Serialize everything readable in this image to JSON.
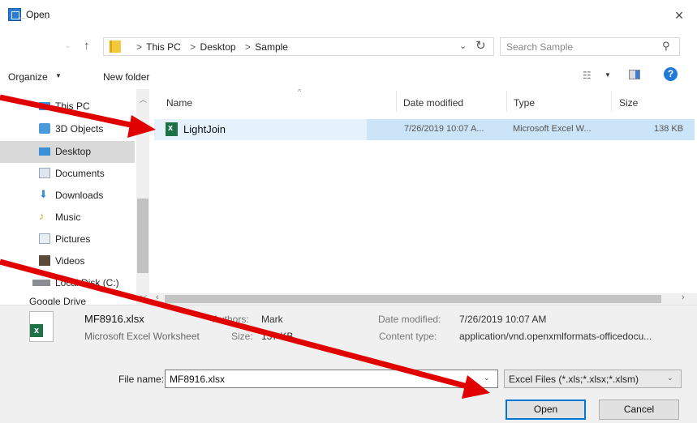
{
  "window": {
    "title": "Open",
    "close_glyph": "×"
  },
  "address": {
    "crumbs": [
      "This PC",
      "Desktop",
      "Sample"
    ],
    "separator": ">",
    "search_placeholder": "Search Sample"
  },
  "toolbar": {
    "organize": "Organize",
    "new_folder": "New folder"
  },
  "sidebar": {
    "items": [
      {
        "label": "This PC",
        "icon": "computer-icon",
        "color": "#3b8ed8"
      },
      {
        "label": "3D Objects",
        "icon": "cube-icon",
        "color": "#4a9bd8"
      },
      {
        "label": "Desktop",
        "icon": "desktop-icon",
        "color": "#3b8ed8",
        "selected": true
      },
      {
        "label": "Documents",
        "icon": "document-icon",
        "color": "#9aa7b8"
      },
      {
        "label": "Downloads",
        "icon": "download-icon",
        "color": "#3b8ed8"
      },
      {
        "label": "Music",
        "icon": "music-icon",
        "color": "#e2a12b"
      },
      {
        "label": "Pictures",
        "icon": "picture-icon",
        "color": "#9aa7b8"
      },
      {
        "label": "Videos",
        "icon": "video-icon",
        "color": "#5b4a3a"
      },
      {
        "label": "Local Disk (C:)",
        "icon": "drive-icon",
        "color": "#8a8f96"
      },
      {
        "label": "Google Drive",
        "icon": "drive-icon",
        "color": "#8a8f96"
      }
    ]
  },
  "columns": {
    "name": "Name",
    "date": "Date modified",
    "type": "Type",
    "size": "Size"
  },
  "files": [
    {
      "name": "LightJoin",
      "date": "7/26/2019 10:07 A...",
      "type": "Microsoft Excel W...",
      "size": "138 KB"
    }
  ],
  "details": {
    "name": "MF8916.xlsx",
    "kind": "Microsoft Excel Worksheet",
    "authors_label": "Authors:",
    "authors_value": "Mark",
    "size_label": "Size:",
    "size_value": "137 KB",
    "modified_label": "Date modified:",
    "modified_value": "7/26/2019 10:07 AM",
    "content_label": "Content type:",
    "content_value": "application/vnd.openxmlformats-officedocu..."
  },
  "footer": {
    "file_name_label": "File name:",
    "file_name_value": "MF8916.xlsx",
    "filter_value": "Excel Files (*.xls;*.xlsx;*.xlsm)",
    "open_label": "Open",
    "cancel_label": "Cancel"
  },
  "colors": {
    "accent": "#0078d7",
    "annotation": "#e00000",
    "excel": "#1e7145"
  }
}
